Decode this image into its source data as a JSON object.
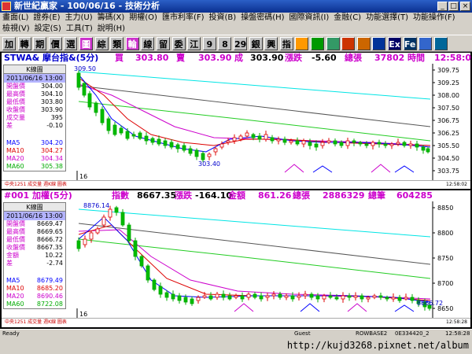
{
  "window": {
    "title": "新世紀贏家 - 100/06/16 - 技術分析",
    "min": "_",
    "max": "□",
    "close": "×"
  },
  "menu_row1": [
    "畫面(L)",
    "證券(E)",
    "主力(U)",
    "籌碼(X)",
    "期權(O)",
    "匯市利率(F)",
    "投資(B)",
    "操盤密碼(H)",
    "國際資訊(I)",
    "金融(C)",
    "功能選擇(T)",
    "功能操作(F)"
  ],
  "menu_row2": [
    "檢視(V)",
    "設定(S)",
    "工具(T)",
    "說明(H)"
  ],
  "toolbar": [
    {
      "label": "加",
      "bg": "#c0c0c0",
      "fg": "#000"
    },
    {
      "label": "轉",
      "bg": "#c0c0c0",
      "fg": "#000"
    },
    {
      "label": "期",
      "bg": "#c0c0c0",
      "fg": "#000"
    },
    {
      "label": "價",
      "bg": "#c0c0c0",
      "fg": "#000"
    },
    {
      "label": "選",
      "bg": "#c0c0c0",
      "fg": "#000"
    },
    {
      "label": "圖",
      "bg": "#cc33cc",
      "fg": "#fff"
    },
    {
      "label": "綜",
      "bg": "#c0c0c0",
      "fg": "#000"
    },
    {
      "label": "類",
      "bg": "#c0c0c0",
      "fg": "#000"
    },
    {
      "label": "輪",
      "bg": "#cc33cc",
      "fg": "#fff"
    },
    {
      "label": "線",
      "bg": "#c0c0c0",
      "fg": "#000"
    },
    {
      "label": "留",
      "bg": "#c0c0c0",
      "fg": "#000"
    },
    {
      "label": "委",
      "bg": "#c0c0c0",
      "fg": "#000"
    },
    {
      "label": "江",
      "bg": "#c0c0c0",
      "fg": "#000"
    },
    {
      "label": "9",
      "bg": "#c0c0c0",
      "fg": "#000"
    },
    {
      "label": "8",
      "bg": "#c0c0c0",
      "fg": "#000"
    },
    {
      "label": "29",
      "bg": "#c0c0c0",
      "fg": "#000"
    },
    {
      "label": "銀",
      "bg": "#c0c0c0",
      "fg": "#000"
    },
    {
      "label": "興",
      "bg": "#c0c0c0",
      "fg": "#000"
    },
    {
      "label": "指",
      "bg": "#c0c0c0",
      "fg": "#000"
    },
    {
      "label": "",
      "bg": "#ff9900",
      "fg": "#000"
    },
    {
      "label": "",
      "bg": "#009900",
      "fg": "#fff"
    },
    {
      "label": "",
      "bg": "#339966",
      "fg": "#fff"
    },
    {
      "label": "",
      "bg": "#cc3300",
      "fg": "#fff"
    },
    {
      "label": "",
      "bg": "#cc6600",
      "fg": "#fff"
    },
    {
      "label": "",
      "bg": "#003399",
      "fg": "#fff"
    },
    {
      "label": "Ex",
      "bg": "#000066",
      "fg": "#fff"
    },
    {
      "label": "Fe",
      "bg": "#003366",
      "fg": "#fff"
    },
    {
      "label": "",
      "bg": "#3366cc",
      "fg": "#fff"
    },
    {
      "label": "",
      "bg": "#006699",
      "fg": "#fff"
    }
  ],
  "panel1": {
    "head": {
      "symbol": "STWA& 摩台指&(5分)",
      "buy_label": "買",
      "buy": "303.80",
      "sell_label": "賣",
      "sell": "303.90",
      "deal_label": "成",
      "deal": "303.90",
      "chg_label": "漲跌",
      "chg": "-5.60",
      "vol_label": "總張",
      "vol": "37802",
      "time_label": "時間",
      "time": "12:58:02"
    },
    "info": {
      "title": "K線圖",
      "date": "2011/06/16 13:00",
      "rows": [
        {
          "label": "開盤價",
          "value": "304.00",
          "color": "#000"
        },
        {
          "label": "最高價",
          "value": "304.10",
          "color": "#000"
        },
        {
          "label": "最低價",
          "value": "303.80",
          "color": "#000"
        },
        {
          "label": "收盤價",
          "value": "303.90",
          "color": "#000"
        },
        {
          "label": "成交量",
          "value": "395",
          "color": "#000"
        },
        {
          "label": "差",
          "value": "-0.10",
          "color": "#000"
        }
      ],
      "ma_rows": [
        {
          "label": "MA5",
          "value": "304.20",
          "color": "#0000ff"
        },
        {
          "label": "MA10",
          "value": "304.27",
          "color": "#dd0000"
        },
        {
          "label": "MA20",
          "value": "304.34",
          "color": "#cc00cc"
        },
        {
          "label": "MA60",
          "value": "305.38",
          "color": "#00aa00"
        }
      ]
    },
    "y_ticks": [
      "309.75",
      "309.25",
      "308.00",
      "307.50",
      "306.75",
      "306.25",
      "305.50",
      "304.50",
      "303.75"
    ],
    "annot_high": "309.50",
    "annot_low": "303.40",
    "period_mark": "16",
    "mini": {
      "left": "中央1251 成交量 週K線 圖表",
      "time": "12:58:02"
    }
  },
  "panel2": {
    "head": {
      "symbol": "#001 加權(5分)",
      "idx_label": "指數",
      "idx": "8667.35",
      "chg_label": "漲跌",
      "chg": "-164.10",
      "amt_label": "金額",
      "amt": "861.26",
      "vol_label": "總張",
      "vol": "2886329",
      "cnt_label": "總筆",
      "cnt": "604285"
    },
    "info": {
      "title": "K線圖",
      "date": "2011/06/16 13:00",
      "rows": [
        {
          "label": "開盤價",
          "value": "8669.47",
          "color": "#000"
        },
        {
          "label": "最高價",
          "value": "8669.65",
          "color": "#000"
        },
        {
          "label": "最低價",
          "value": "8666.72",
          "color": "#000"
        },
        {
          "label": "收盤價",
          "value": "8667.35",
          "color": "#000"
        },
        {
          "label": "金額",
          "value": "10.22",
          "color": "#000"
        },
        {
          "label": "差",
          "value": "-2.74",
          "color": "#000"
        }
      ],
      "ma_rows": [
        {
          "label": "MA5",
          "value": "8679.49",
          "color": "#0000ff"
        },
        {
          "label": "MA10",
          "value": "8685.20",
          "color": "#dd0000"
        },
        {
          "label": "MA20",
          "value": "8690.46",
          "color": "#cc00cc"
        },
        {
          "label": "MA60",
          "value": "8722.08",
          "color": "#00aa00"
        }
      ]
    },
    "y_ticks": [
      "8850",
      "8800",
      "8750",
      "8700",
      "8650"
    ],
    "annot_high": "8876.14",
    "annot_low": "8666.72",
    "period_mark": "16",
    "mini": {
      "left": "中央1251 成交量 週K線 圖表",
      "time": "12:58:28"
    }
  },
  "status": {
    "ready": "Ready",
    "guest": "Guest",
    "host": "ROWBASE2",
    "code": "0E334420_2",
    "clock": "12:58:28"
  },
  "watermark": "http://kujd3268.pixnet.net/album"
}
